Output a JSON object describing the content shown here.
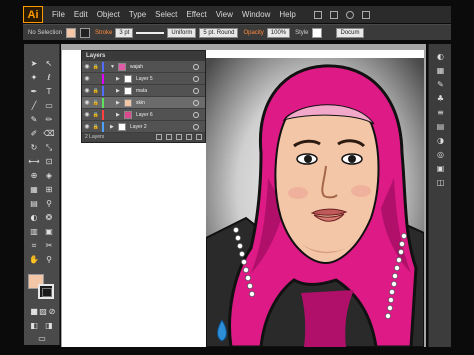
{
  "menubar": {
    "logo": "Ai",
    "items": [
      "File",
      "Edit",
      "Object",
      "Type",
      "Select",
      "Effect",
      "View",
      "Window",
      "Help"
    ]
  },
  "controlbar": {
    "selection": "No Selection",
    "stroke_label": "Stroke",
    "stroke_weight": "3 pt",
    "uniform": "Uniform",
    "brush": "5 pt. Round",
    "opacity_label": "Opacity",
    "opacity_value": "100%",
    "style_label": "Style",
    "document": "Docum"
  },
  "layers_panel": {
    "title": "Layers",
    "layers": [
      {
        "name": "wajah",
        "color": "#4f6dff",
        "expanded": true
      },
      {
        "name": "Layer 5",
        "color": "#e000ff",
        "expanded": false
      },
      {
        "name": "mata",
        "color": "#4f6dff",
        "expanded": false
      },
      {
        "name": "skin",
        "color": "#5fe05f",
        "expanded": false
      },
      {
        "name": "Layer 6",
        "color": "#ff4040",
        "expanded": false
      },
      {
        "name": "Layer 2",
        "color": "#4fa0ff",
        "expanded": false
      }
    ],
    "footer": "2 Layers"
  },
  "tool_colors": {
    "fill": "#f4c6a8",
    "stroke": "#1a1a1a"
  },
  "colors": {
    "hijab": "#dd1a86",
    "skin": "#f4c6a8",
    "accent": "#ff9a00"
  }
}
